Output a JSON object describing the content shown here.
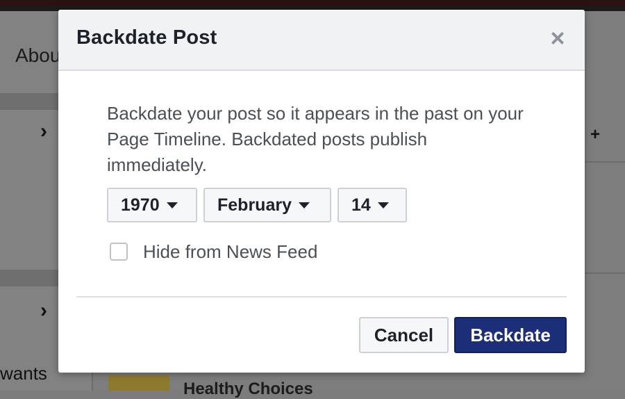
{
  "background": {
    "about_text": "Abou",
    "wants_text": "wants",
    "healthy_text": "Healthy Choices",
    "chevron_glyph": "›",
    "plus_glyph": "+"
  },
  "dialog": {
    "title": "Backdate Post",
    "close_glyph": "×",
    "description": "Backdate your post so it appears in the past on your Page Timeline. Backdated posts publish immediately.",
    "year": "1970",
    "month": "February",
    "day": "14",
    "checkbox_label": "Hide from News Feed",
    "checkbox_checked": false,
    "cancel_label": "Cancel",
    "backdate_label": "Backdate"
  },
  "colors": {
    "primary_button": "#1c2e78",
    "header_bg": "#f1f2f4",
    "text": "#4b4f56"
  }
}
